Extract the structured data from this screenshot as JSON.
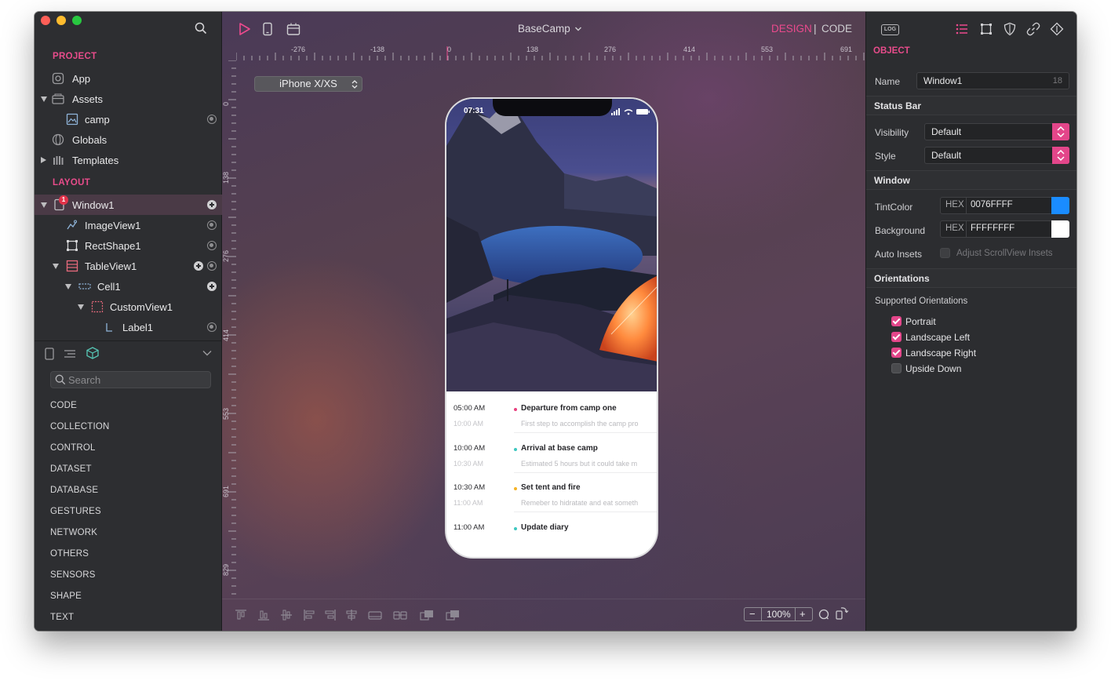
{
  "sidebar": {
    "project_title": "PROJECT",
    "project_items": [
      {
        "label": "App",
        "icon": "app-icon"
      },
      {
        "label": "Assets",
        "icon": "assets-icon"
      },
      {
        "label": "camp",
        "icon": "image-asset-icon"
      },
      {
        "label": "Globals",
        "icon": "globals-icon"
      },
      {
        "label": "Templates",
        "icon": "templates-icon"
      }
    ],
    "layout_title": "LAYOUT",
    "layout_items": [
      {
        "label": "Window1",
        "icon": "window-icon",
        "badge": "1"
      },
      {
        "label": "ImageView1",
        "icon": "imageview-icon"
      },
      {
        "label": "RectShape1",
        "icon": "rectshape-icon"
      },
      {
        "label": "TableView1",
        "icon": "tableview-icon"
      },
      {
        "label": "Cell1",
        "icon": "cell-icon"
      },
      {
        "label": "CustomView1",
        "icon": "customview-icon"
      },
      {
        "label": "Label1",
        "icon": "label-icon"
      }
    ],
    "search_placeholder": "Search",
    "categories": [
      "CODE",
      "COLLECTION",
      "CONTROL",
      "DATASET",
      "DATABASE",
      "GESTURES",
      "NETWORK",
      "OTHERS",
      "SENSORS",
      "SHAPE",
      "TEXT"
    ]
  },
  "toolbar": {
    "project_name": "BaseCamp",
    "mode_design": "DESIGN",
    "mode_separator": "|",
    "mode_code": "CODE"
  },
  "ruler": {
    "h_labels": [
      "-276",
      "-138",
      "0",
      "138",
      "276",
      "414",
      "553",
      "691"
    ],
    "v_labels": [
      "0",
      "138",
      "276",
      "414",
      "553",
      "691",
      "829"
    ]
  },
  "canvas": {
    "device": "iPhone X/XS",
    "zoom": "100%",
    "zoom_minus": "−",
    "zoom_plus": "+"
  },
  "phone": {
    "status_time": "07:31",
    "timeline": [
      {
        "time": "05:00 AM",
        "end_time": "10:00 AM",
        "title": "Departure from camp one",
        "desc": "First step to accomplish the camp pro",
        "dot_color": "#e8417f"
      },
      {
        "time": "10:00 AM",
        "end_time": "10:30 AM",
        "title": "Arrival at base camp",
        "desc": "Estimated 5 hours but it could take m",
        "dot_color": "#3ec7c0"
      },
      {
        "time": "10:30 AM",
        "end_time": "11:00 AM",
        "title": "Set tent and fire",
        "desc": "Remeber to hidratate and eat someth",
        "dot_color": "#f5b325"
      },
      {
        "time": "11:00 AM",
        "end_time": "",
        "title": "Update diary",
        "desc": "",
        "dot_color": "#3ec7c0"
      }
    ]
  },
  "inspector": {
    "log_label": "LOG",
    "object_title": "OBJECT",
    "name_label": "Name",
    "name_value": "Window1",
    "name_count": "18",
    "status_bar_header": "Status Bar",
    "visibility_label": "Visibility",
    "visibility_value": "Default",
    "style_label": "Style",
    "style_value": "Default",
    "window_header": "Window",
    "tint_label": "TintColor",
    "tint_prefix": "HEX",
    "tint_value": "0076FFFF",
    "tint_swatch": "#1a8cff",
    "background_label": "Background",
    "background_prefix": "HEX",
    "background_value": "FFFFFFFF",
    "background_swatch": "#ffffff",
    "auto_insets_label": "Auto Insets",
    "adjust_label": "Adjust ScrollView Insets",
    "orientations_header": "Orientations",
    "supported_label": "Supported Orientations",
    "orientations": [
      {
        "label": "Portrait",
        "checked": true
      },
      {
        "label": "Landscape Left",
        "checked": true
      },
      {
        "label": "Landscape Right",
        "checked": true
      },
      {
        "label": "Upside Down",
        "checked": false
      }
    ]
  },
  "colors": {
    "accent": "#e84c8b",
    "sidebar_bg": "#2d2e31",
    "selected_row": "#4a3a46"
  }
}
